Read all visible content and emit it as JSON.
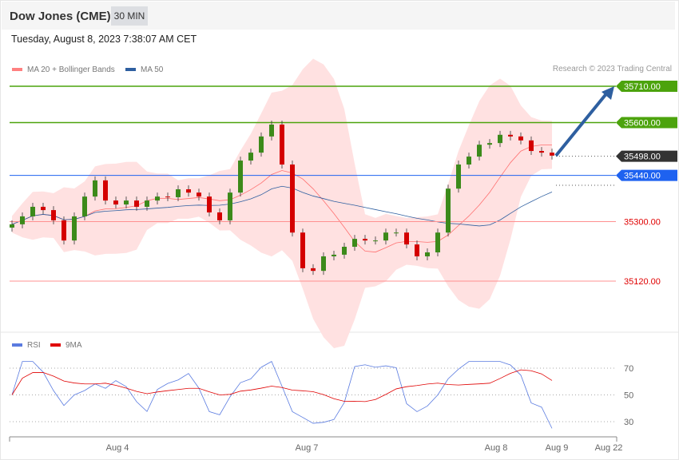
{
  "header": {
    "title": "Dow Jones (CME)",
    "timeframe": "30 MIN",
    "date": "Tuesday, August 8, 2023 7:38:07 AM CET"
  },
  "legend": {
    "ma20": "MA 20 + Bollinger Bands",
    "ma50": "MA 50",
    "credit": "Research © 2023 Trading Central",
    "rsi": "RSI",
    "ma9": "9MA"
  },
  "colors": {
    "green": "#4ca30d",
    "blue": "#1e62f0",
    "dark": "#333333",
    "red": "#e00000",
    "ma50": "#2e5fa0",
    "band": "#ffe1e1",
    "up": "#3c8a1a",
    "down": "#d40000"
  },
  "chart_data": {
    "type": "candlestick",
    "price_range": [
      35120,
      35710
    ],
    "closes": [
      35292,
      35316,
      35345,
      35335,
      35304,
      35243,
      35316,
      35376,
      35425,
      35364,
      35352,
      35364,
      35345,
      35364,
      35376,
      35374,
      35398,
      35388,
      35376,
      35328,
      35304,
      35388,
      35485,
      35509,
      35558,
      35594,
      35473,
      35267,
      35159,
      35151,
      35195,
      35200,
      35224,
      35248,
      35243,
      35243,
      35267,
      35267,
      35231,
      35195,
      35207,
      35267,
      35400,
      35473,
      35497,
      35533,
      35538,
      35563,
      35558,
      35546,
      35514,
      35509,
      35500
    ],
    "levels": [
      {
        "value": 35710,
        "label": "35710.00",
        "kind": "resistance"
      },
      {
        "value": 35600,
        "label": "35600.00",
        "kind": "resistance"
      },
      {
        "value": 35498,
        "label": "35498.00",
        "kind": "last"
      },
      {
        "value": 35440,
        "label": "35440.00",
        "kind": "pivot"
      },
      {
        "value": 35300,
        "label": "35300.00",
        "kind": "support"
      },
      {
        "value": 35120,
        "label": "35120.00",
        "kind": "support"
      }
    ],
    "target": 35710,
    "rsi_ticks": [
      "70",
      "50",
      "30"
    ],
    "rsi_values": [
      70,
      50,
      30
    ],
    "x_labels": [
      "Aug 4",
      "Aug 7",
      "Aug 8",
      "Aug 9",
      "Aug 22"
    ]
  }
}
